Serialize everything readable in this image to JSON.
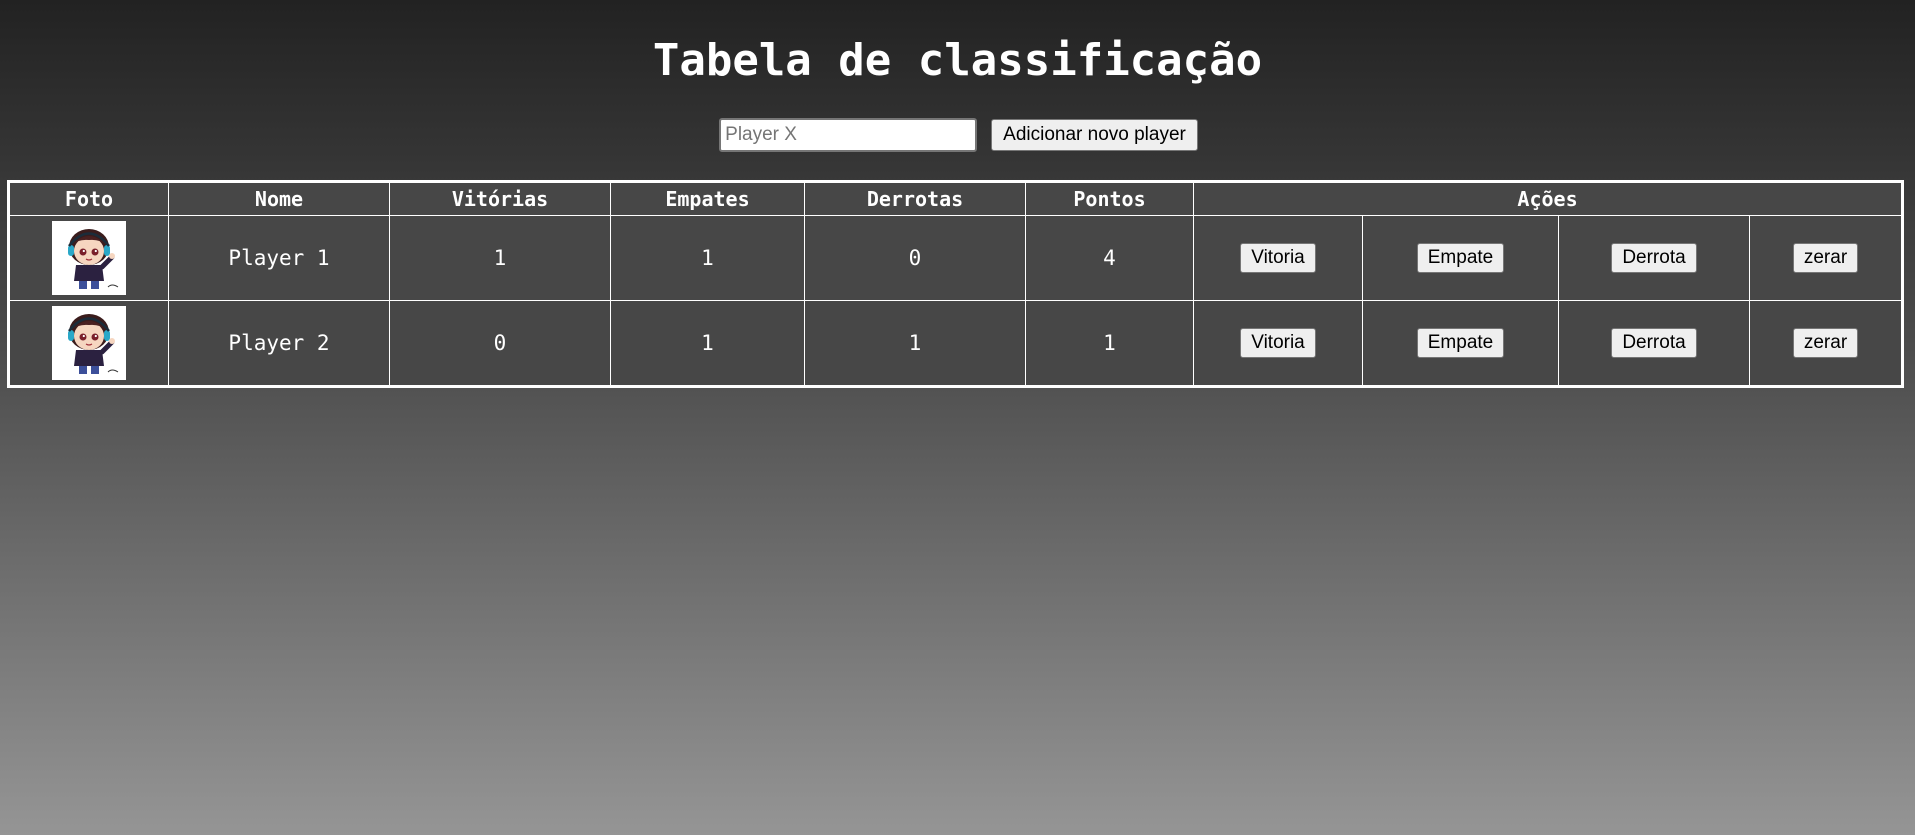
{
  "page": {
    "title": "Tabela de classificação"
  },
  "add_player": {
    "placeholder": "Player X",
    "value": "",
    "button_label": "Adicionar novo player"
  },
  "table": {
    "headers": {
      "foto": "Foto",
      "nome": "Nome",
      "vitorias": "Vitórias",
      "empates": "Empates",
      "derrotas": "Derrotas",
      "pontos": "Pontos",
      "acoes": "Ações"
    },
    "rows": [
      {
        "avatar_icon": "chibi-gamer-avatar",
        "nome": "Player 1",
        "vitorias": "1",
        "empates": "1",
        "derrotas": "0",
        "pontos": "4",
        "actions": {
          "vitoria": "Vitoria",
          "empate": "Empate",
          "derrota": "Derrota",
          "zerar": "zerar"
        }
      },
      {
        "avatar_icon": "chibi-gamer-avatar",
        "nome": "Player 2",
        "vitorias": "0",
        "empates": "1",
        "derrotas": "1",
        "pontos": "1",
        "actions": {
          "vitoria": "Vitoria",
          "empate": "Empate",
          "derrota": "Derrota",
          "zerar": "zerar"
        }
      }
    ]
  },
  "colors": {
    "gradient_top": "#222222",
    "gradient_bottom": "#959595",
    "table_bg": "#474747",
    "border": "#ffffff",
    "text": "#ffffff"
  }
}
